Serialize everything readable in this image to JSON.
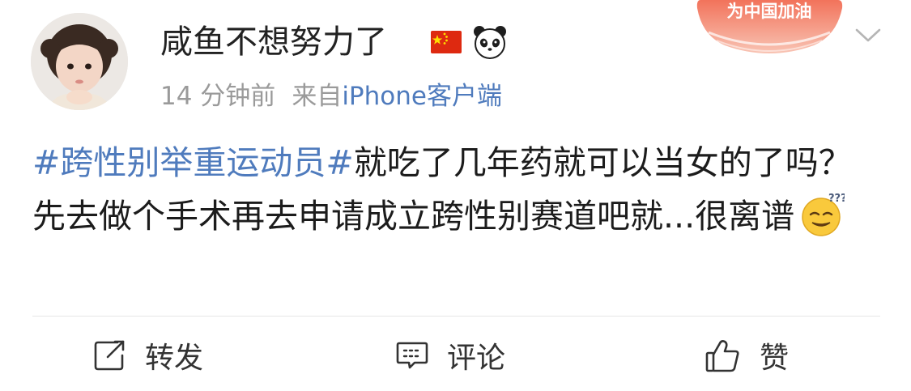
{
  "user": {
    "name": "咸鱼不想努力了",
    "badges": [
      "china-flag-icon",
      "panda-icon"
    ]
  },
  "meta": {
    "time": "14 分钟前",
    "from_label": "来自",
    "source": "iPhone客户端"
  },
  "sticker": {
    "text": "为中国加油",
    "color": "#e8402f"
  },
  "post": {
    "hashtag": "#跨性别举重运动员#",
    "text": "就吃了几年药就可以当女的了吗？先去做个手术再去申请成立跨性别赛道吧就...很离谱",
    "emoji": "confused-face-icon"
  },
  "actions": {
    "repost": "转发",
    "comment": "评论",
    "like": "赞"
  },
  "colors": {
    "link": "#4f7bbd",
    "text": "#1c1c1c",
    "meta": "#9a9a9a"
  }
}
